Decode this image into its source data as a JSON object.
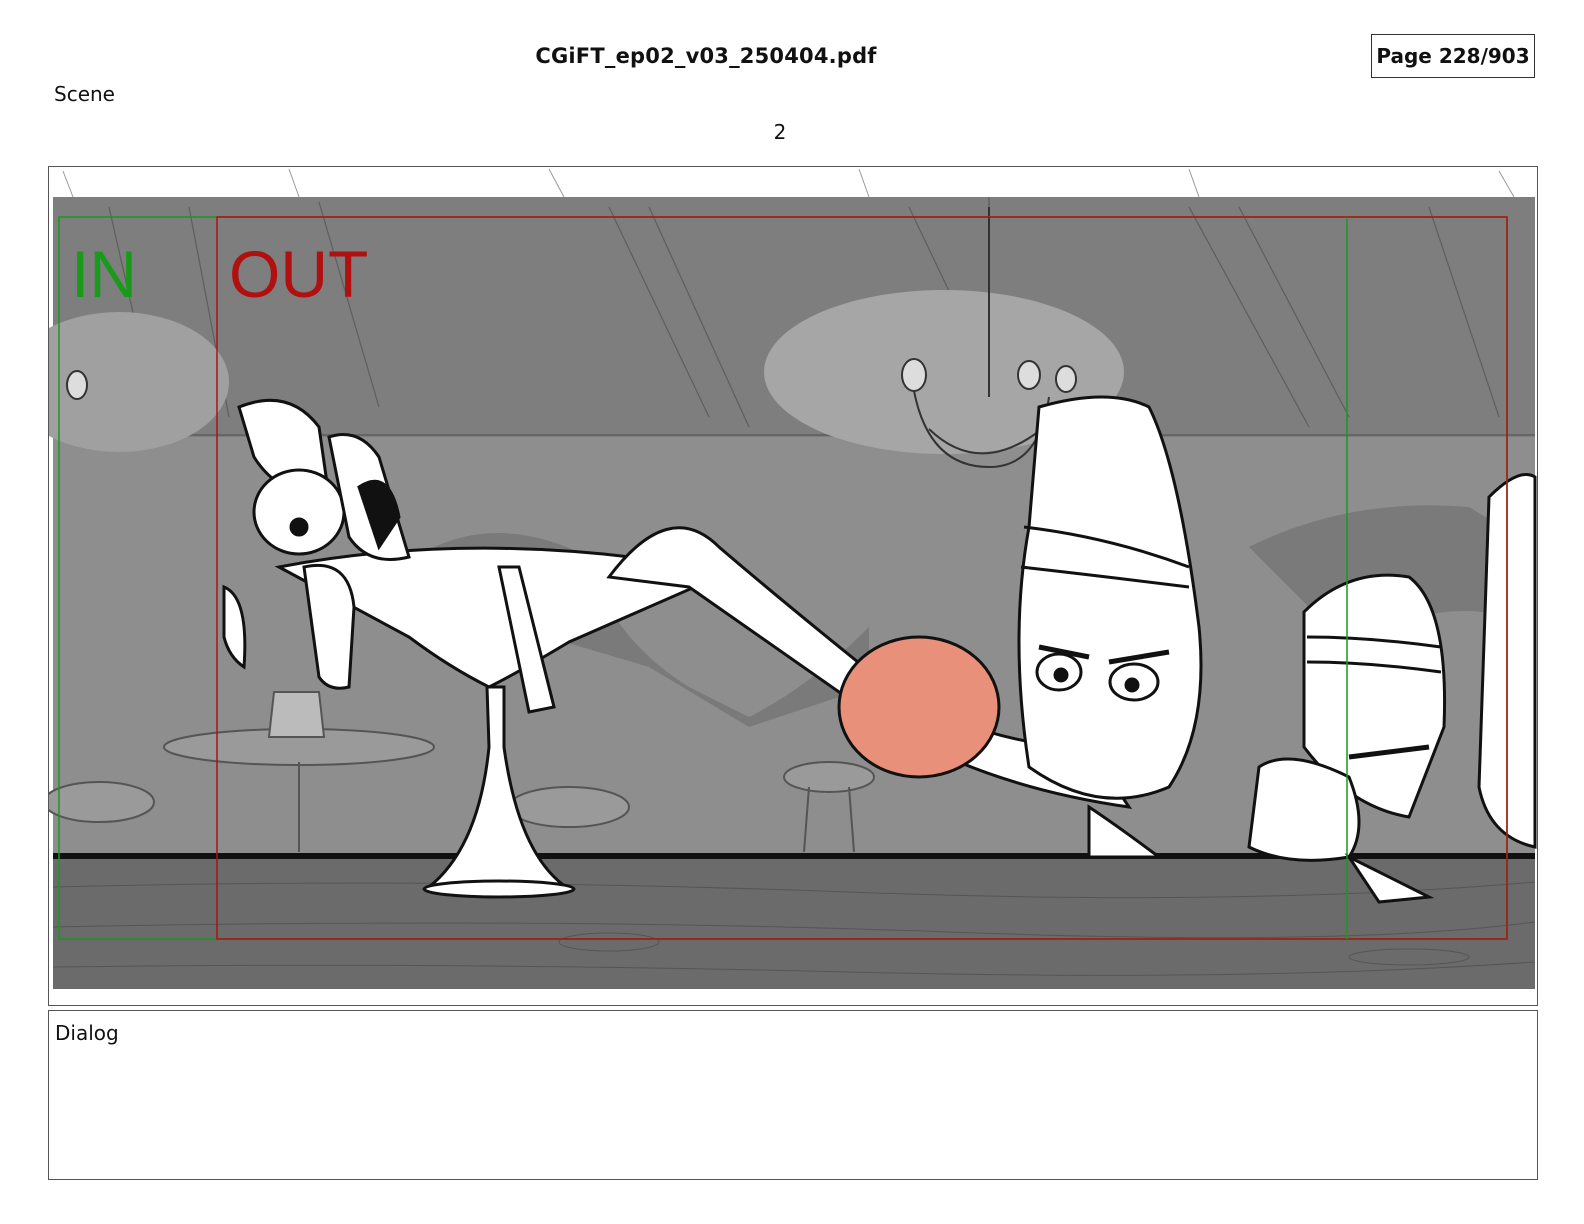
{
  "header": {
    "file_title": "CGiFT_ep02_v03_250404.pdf",
    "page_indicator": "Page 228/903"
  },
  "scene": {
    "label": "Scene",
    "number": "2"
  },
  "frame_guides": {
    "in_label": "IN",
    "out_label": "OUT",
    "in_color": "#1a9a1a",
    "out_color": "#b01010"
  },
  "dialog": {
    "label": "Dialog",
    "text": ""
  },
  "colors": {
    "background_gray": "#8e8e8e",
    "ceiling_gray": "#7c7c7c",
    "counter_wood": "#6d6d6d",
    "skin_salmon": "#e8907a"
  }
}
